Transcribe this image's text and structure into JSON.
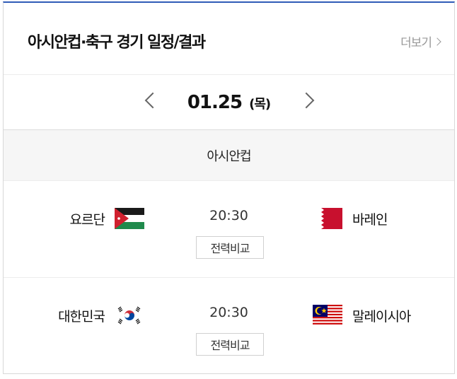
{
  "header": {
    "title": "아시안컵·축구 경기 일정/결과",
    "more_label": "더보기"
  },
  "datebar": {
    "date": "01.25",
    "day_of_week": "(목)"
  },
  "league": "아시안컵",
  "matches": [
    {
      "home": "요르단",
      "home_flag": "jordan-flag-icon",
      "time": "20:30",
      "away": "바레인",
      "away_flag": "bahrain-flag-icon",
      "compare_label": "전력비교"
    },
    {
      "home": "대한민국",
      "home_flag": "south-korea-flag-icon",
      "time": "20:30",
      "away": "말레이시아",
      "away_flag": "malaysia-flag-icon",
      "compare_label": "전력비교"
    }
  ],
  "colors": {
    "accent_top_border": "#2f5bb7",
    "league_bg": "#f6f6f6",
    "more_text": "#999999"
  }
}
